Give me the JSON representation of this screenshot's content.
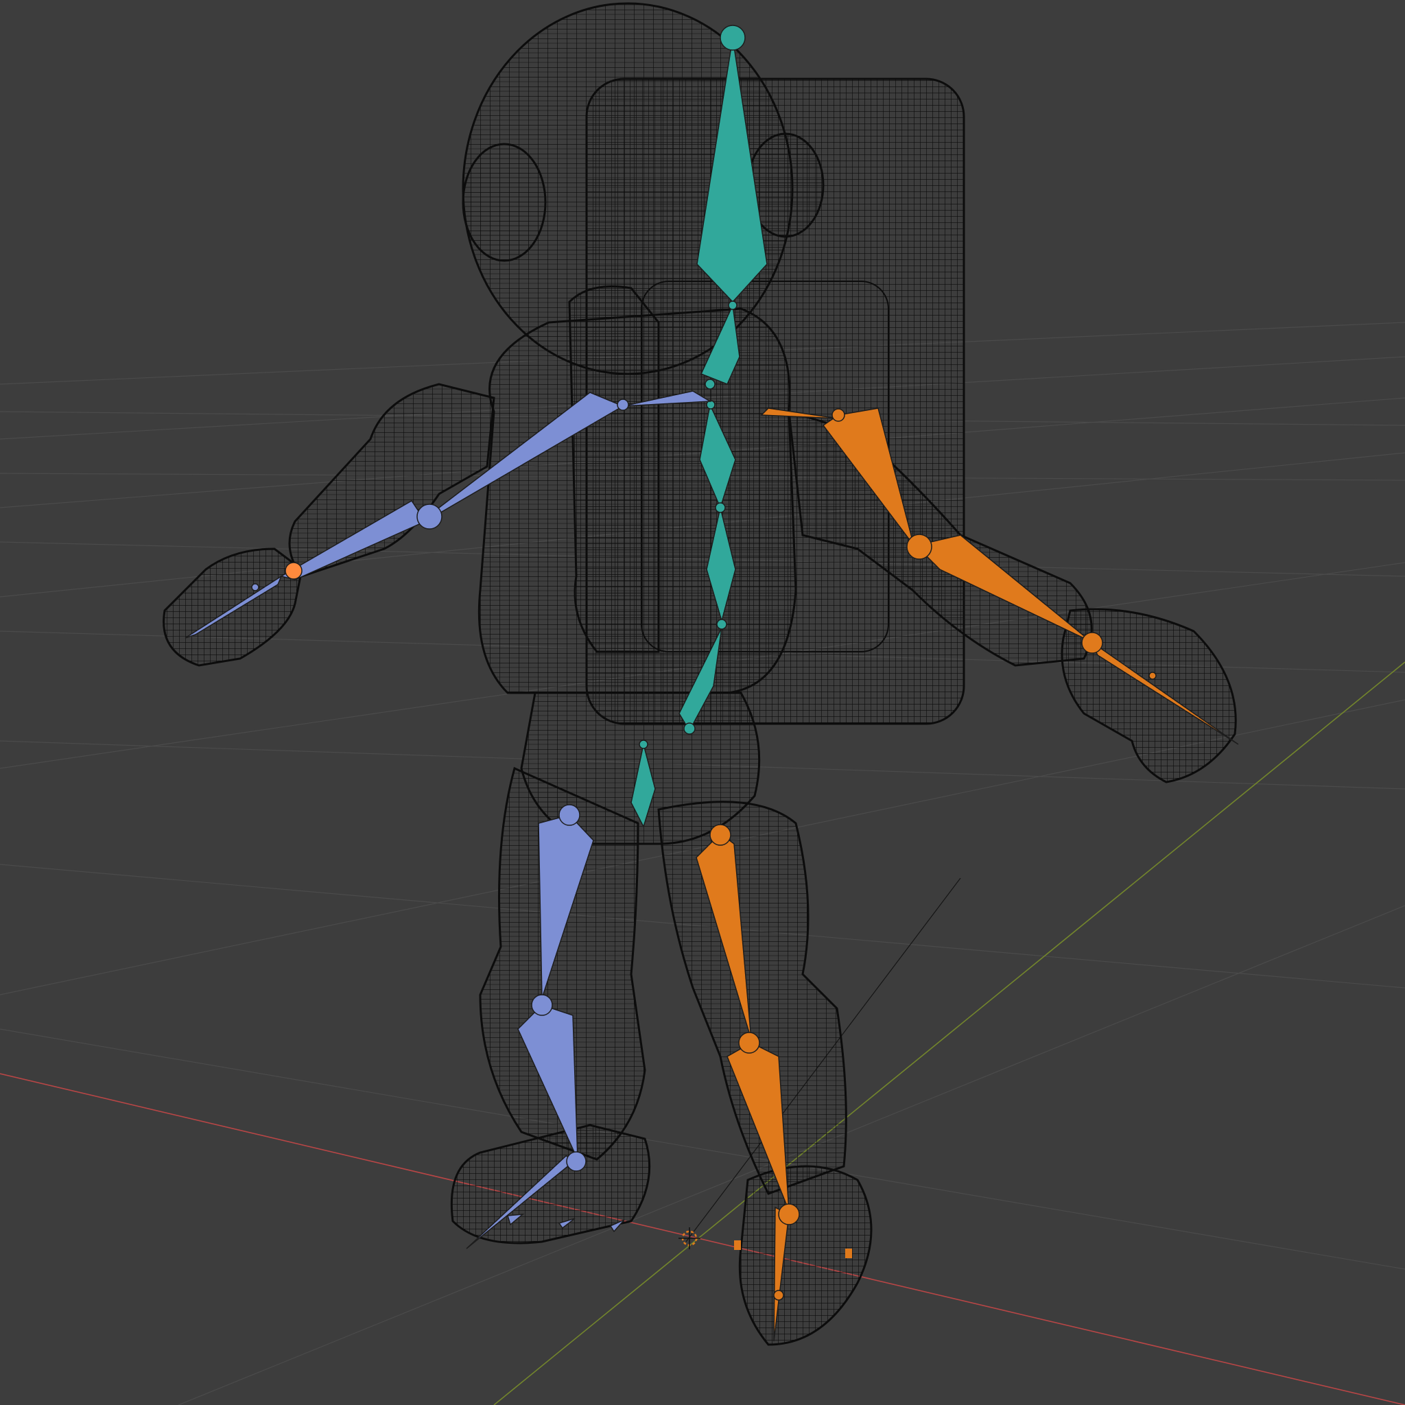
{
  "viewport": {
    "background": "#3d3d3d",
    "grid_color": "#4a4a4a",
    "x_axis_color": "#b84646",
    "y_axis_color": "#73862c"
  },
  "mesh": {
    "wire_color": "#0c0c0c",
    "name": "astronaut-character"
  },
  "armature": {
    "spine_color": "#31a89b",
    "left_side_color": "#7d8fd4",
    "right_side_color": "#e07a1c",
    "selected_joint_color": "#ff8a3d"
  },
  "icons": {
    "origin": "3d-cursor-icon"
  }
}
